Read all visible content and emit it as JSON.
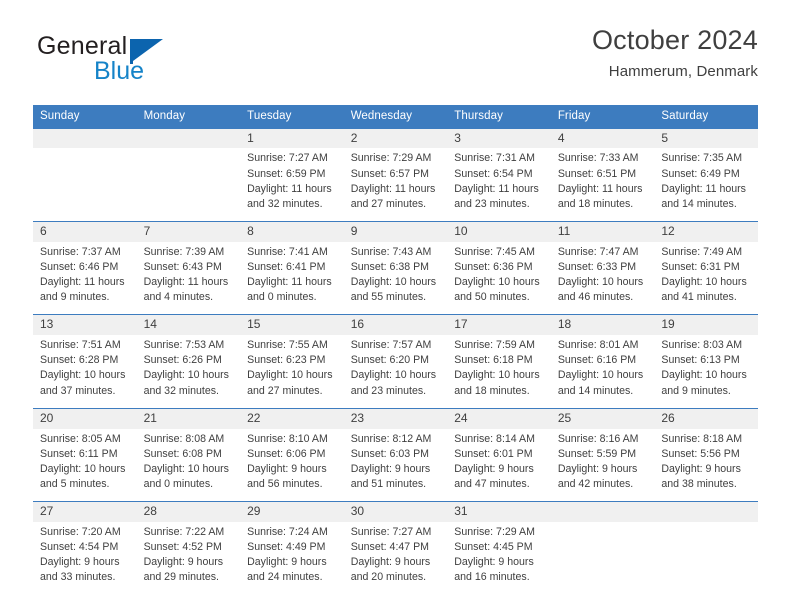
{
  "brand": {
    "name_dark": "General",
    "name_blue": "Blue",
    "accent_blue": "#1583c8",
    "logo_blue": "#0c64ae"
  },
  "header": {
    "title": "October 2024",
    "subtitle": "Hammerum, Denmark",
    "header_bg": "#3d7cbf",
    "day_band_bg": "#f0f0f0"
  },
  "weekday_headers": [
    "Sunday",
    "Monday",
    "Tuesday",
    "Wednesday",
    "Thursday",
    "Friday",
    "Saturday"
  ],
  "labels": {
    "sunrise_prefix": "Sunrise:",
    "sunset_prefix": "Sunset:",
    "daylight_prefix": "Daylight:"
  },
  "weeks": [
    [
      {
        "day": "",
        "sunrise": "",
        "sunset": "",
        "daylight_line1": "",
        "daylight_line2": ""
      },
      {
        "day": "",
        "sunrise": "",
        "sunset": "",
        "daylight_line1": "",
        "daylight_line2": ""
      },
      {
        "day": "1",
        "sunrise": "Sunrise: 7:27 AM",
        "sunset": "Sunset: 6:59 PM",
        "daylight_line1": "Daylight: 11 hours",
        "daylight_line2": "and 32 minutes."
      },
      {
        "day": "2",
        "sunrise": "Sunrise: 7:29 AM",
        "sunset": "Sunset: 6:57 PM",
        "daylight_line1": "Daylight: 11 hours",
        "daylight_line2": "and 27 minutes."
      },
      {
        "day": "3",
        "sunrise": "Sunrise: 7:31 AM",
        "sunset": "Sunset: 6:54 PM",
        "daylight_line1": "Daylight: 11 hours",
        "daylight_line2": "and 23 minutes."
      },
      {
        "day": "4",
        "sunrise": "Sunrise: 7:33 AM",
        "sunset": "Sunset: 6:51 PM",
        "daylight_line1": "Daylight: 11 hours",
        "daylight_line2": "and 18 minutes."
      },
      {
        "day": "5",
        "sunrise": "Sunrise: 7:35 AM",
        "sunset": "Sunset: 6:49 PM",
        "daylight_line1": "Daylight: 11 hours",
        "daylight_line2": "and 14 minutes."
      }
    ],
    [
      {
        "day": "6",
        "sunrise": "Sunrise: 7:37 AM",
        "sunset": "Sunset: 6:46 PM",
        "daylight_line1": "Daylight: 11 hours",
        "daylight_line2": "and 9 minutes."
      },
      {
        "day": "7",
        "sunrise": "Sunrise: 7:39 AM",
        "sunset": "Sunset: 6:43 PM",
        "daylight_line1": "Daylight: 11 hours",
        "daylight_line2": "and 4 minutes."
      },
      {
        "day": "8",
        "sunrise": "Sunrise: 7:41 AM",
        "sunset": "Sunset: 6:41 PM",
        "daylight_line1": "Daylight: 11 hours",
        "daylight_line2": "and 0 minutes."
      },
      {
        "day": "9",
        "sunrise": "Sunrise: 7:43 AM",
        "sunset": "Sunset: 6:38 PM",
        "daylight_line1": "Daylight: 10 hours",
        "daylight_line2": "and 55 minutes."
      },
      {
        "day": "10",
        "sunrise": "Sunrise: 7:45 AM",
        "sunset": "Sunset: 6:36 PM",
        "daylight_line1": "Daylight: 10 hours",
        "daylight_line2": "and 50 minutes."
      },
      {
        "day": "11",
        "sunrise": "Sunrise: 7:47 AM",
        "sunset": "Sunset: 6:33 PM",
        "daylight_line1": "Daylight: 10 hours",
        "daylight_line2": "and 46 minutes."
      },
      {
        "day": "12",
        "sunrise": "Sunrise: 7:49 AM",
        "sunset": "Sunset: 6:31 PM",
        "daylight_line1": "Daylight: 10 hours",
        "daylight_line2": "and 41 minutes."
      }
    ],
    [
      {
        "day": "13",
        "sunrise": "Sunrise: 7:51 AM",
        "sunset": "Sunset: 6:28 PM",
        "daylight_line1": "Daylight: 10 hours",
        "daylight_line2": "and 37 minutes."
      },
      {
        "day": "14",
        "sunrise": "Sunrise: 7:53 AM",
        "sunset": "Sunset: 6:26 PM",
        "daylight_line1": "Daylight: 10 hours",
        "daylight_line2": "and 32 minutes."
      },
      {
        "day": "15",
        "sunrise": "Sunrise: 7:55 AM",
        "sunset": "Sunset: 6:23 PM",
        "daylight_line1": "Daylight: 10 hours",
        "daylight_line2": "and 27 minutes."
      },
      {
        "day": "16",
        "sunrise": "Sunrise: 7:57 AM",
        "sunset": "Sunset: 6:20 PM",
        "daylight_line1": "Daylight: 10 hours",
        "daylight_line2": "and 23 minutes."
      },
      {
        "day": "17",
        "sunrise": "Sunrise: 7:59 AM",
        "sunset": "Sunset: 6:18 PM",
        "daylight_line1": "Daylight: 10 hours",
        "daylight_line2": "and 18 minutes."
      },
      {
        "day": "18",
        "sunrise": "Sunrise: 8:01 AM",
        "sunset": "Sunset: 6:16 PM",
        "daylight_line1": "Daylight: 10 hours",
        "daylight_line2": "and 14 minutes."
      },
      {
        "day": "19",
        "sunrise": "Sunrise: 8:03 AM",
        "sunset": "Sunset: 6:13 PM",
        "daylight_line1": "Daylight: 10 hours",
        "daylight_line2": "and 9 minutes."
      }
    ],
    [
      {
        "day": "20",
        "sunrise": "Sunrise: 8:05 AM",
        "sunset": "Sunset: 6:11 PM",
        "daylight_line1": "Daylight: 10 hours",
        "daylight_line2": "and 5 minutes."
      },
      {
        "day": "21",
        "sunrise": "Sunrise: 8:08 AM",
        "sunset": "Sunset: 6:08 PM",
        "daylight_line1": "Daylight: 10 hours",
        "daylight_line2": "and 0 minutes."
      },
      {
        "day": "22",
        "sunrise": "Sunrise: 8:10 AM",
        "sunset": "Sunset: 6:06 PM",
        "daylight_line1": "Daylight: 9 hours",
        "daylight_line2": "and 56 minutes."
      },
      {
        "day": "23",
        "sunrise": "Sunrise: 8:12 AM",
        "sunset": "Sunset: 6:03 PM",
        "daylight_line1": "Daylight: 9 hours",
        "daylight_line2": "and 51 minutes."
      },
      {
        "day": "24",
        "sunrise": "Sunrise: 8:14 AM",
        "sunset": "Sunset: 6:01 PM",
        "daylight_line1": "Daylight: 9 hours",
        "daylight_line2": "and 47 minutes."
      },
      {
        "day": "25",
        "sunrise": "Sunrise: 8:16 AM",
        "sunset": "Sunset: 5:59 PM",
        "daylight_line1": "Daylight: 9 hours",
        "daylight_line2": "and 42 minutes."
      },
      {
        "day": "26",
        "sunrise": "Sunrise: 8:18 AM",
        "sunset": "Sunset: 5:56 PM",
        "daylight_line1": "Daylight: 9 hours",
        "daylight_line2": "and 38 minutes."
      }
    ],
    [
      {
        "day": "27",
        "sunrise": "Sunrise: 7:20 AM",
        "sunset": "Sunset: 4:54 PM",
        "daylight_line1": "Daylight: 9 hours",
        "daylight_line2": "and 33 minutes."
      },
      {
        "day": "28",
        "sunrise": "Sunrise: 7:22 AM",
        "sunset": "Sunset: 4:52 PM",
        "daylight_line1": "Daylight: 9 hours",
        "daylight_line2": "and 29 minutes."
      },
      {
        "day": "29",
        "sunrise": "Sunrise: 7:24 AM",
        "sunset": "Sunset: 4:49 PM",
        "daylight_line1": "Daylight: 9 hours",
        "daylight_line2": "and 24 minutes."
      },
      {
        "day": "30",
        "sunrise": "Sunrise: 7:27 AM",
        "sunset": "Sunset: 4:47 PM",
        "daylight_line1": "Daylight: 9 hours",
        "daylight_line2": "and 20 minutes."
      },
      {
        "day": "31",
        "sunrise": "Sunrise: 7:29 AM",
        "sunset": "Sunset: 4:45 PM",
        "daylight_line1": "Daylight: 9 hours",
        "daylight_line2": "and 16 minutes."
      },
      {
        "day": "",
        "sunrise": "",
        "sunset": "",
        "daylight_line1": "",
        "daylight_line2": ""
      },
      {
        "day": "",
        "sunrise": "",
        "sunset": "",
        "daylight_line1": "",
        "daylight_line2": ""
      }
    ]
  ]
}
